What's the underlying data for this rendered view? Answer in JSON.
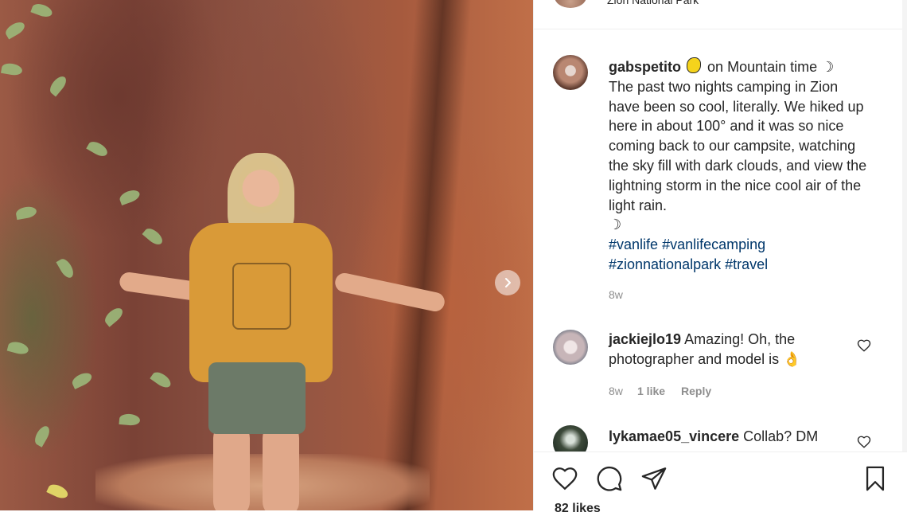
{
  "post": {
    "header": {
      "location": "Zion National Park"
    },
    "caption": {
      "username": "gabspetito",
      "line_intro": "on Mountain time ",
      "moon_glyph": "☽",
      "body": "The past two nights camping in Zion have been so cool, literally. We hiked up here in about 100° and it was so nice coming back to our campsite, watching the sky fill with dark clouds, and view the lightning storm in the nice cool air of the light rain.",
      "moon_end": "☽",
      "hashtags": [
        "#vanlife",
        "#vanlifecamping",
        "#zionnationalpark",
        "#travel"
      ],
      "age": "8w"
    },
    "comments": [
      {
        "username": "jackiejlo19",
        "text": "Amazing! Oh, the photographer and model is 👌",
        "age": "8w",
        "likes": "1 like",
        "reply_label": "Reply"
      },
      {
        "username": "lykamae05_vincere",
        "text": "Collab? DM"
      }
    ],
    "likes_count": "82 likes"
  },
  "icons": {
    "next": "chevron-right-icon",
    "like": "heart-icon",
    "comment": "comment-icon",
    "share": "share-icon",
    "save": "bookmark-icon",
    "comment_like": "heart-icon-small"
  }
}
